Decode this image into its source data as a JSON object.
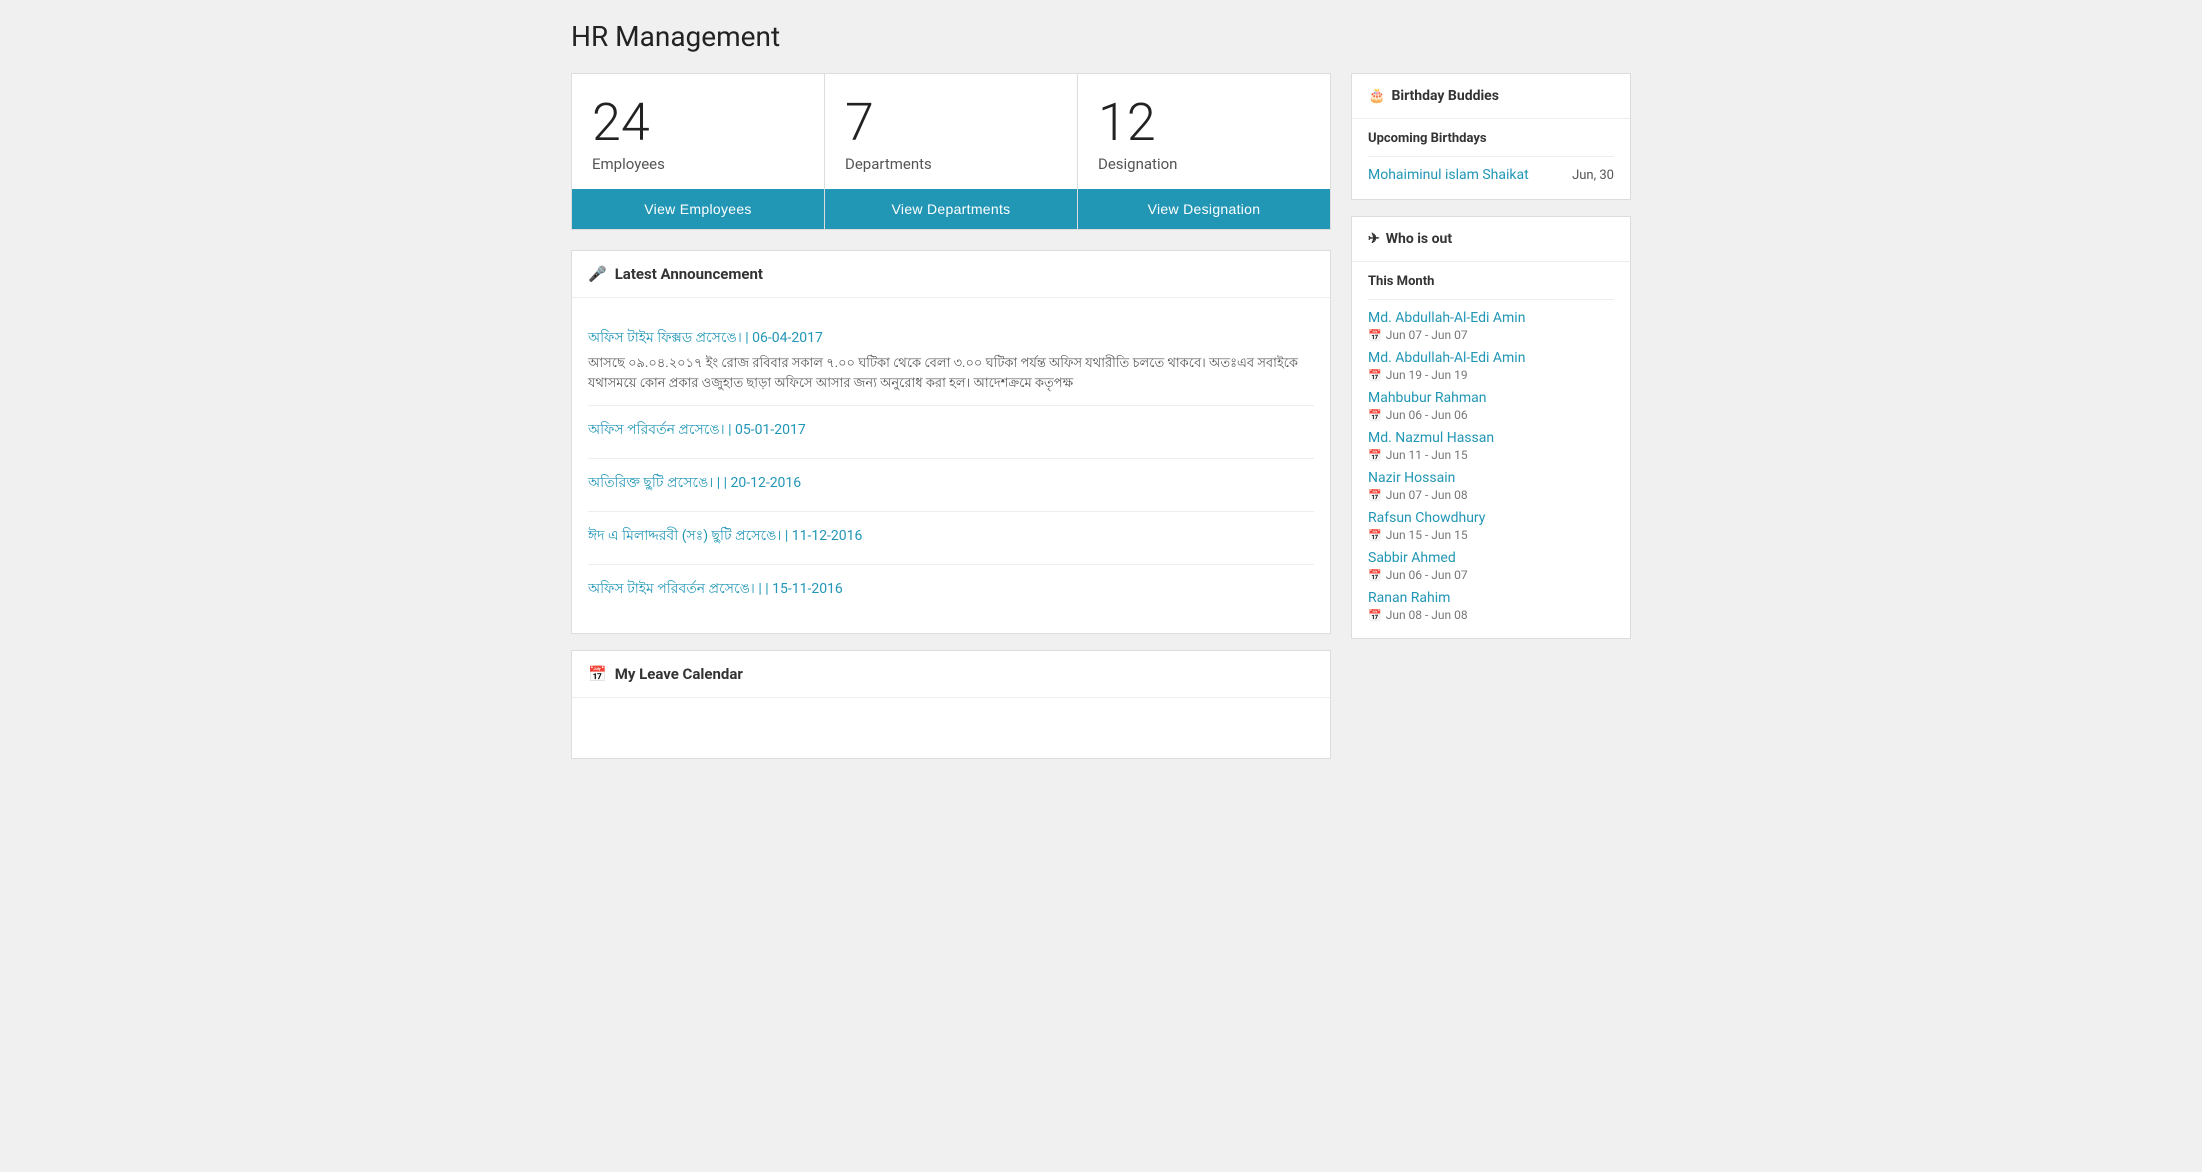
{
  "page": {
    "title": "HR Management"
  },
  "stat_cards": [
    {
      "number": "24",
      "label": "Employees",
      "button_label": "View Employees"
    },
    {
      "number": "7",
      "label": "Departments",
      "button_label": "View Departments"
    },
    {
      "number": "12",
      "label": "Designation",
      "button_label": "View Designation"
    }
  ],
  "latest_announcement": {
    "header": "Latest Announcement",
    "icon": "🎤",
    "items": [
      {
        "title": "অফিস টাইম ফিক্সড প্রসেঙে। | 06-04-2017",
        "detail": "আসছে ০৯.০৪.২০১৭ ইং রোজ রবিবার সকাল ৭.০০ ঘটিকা থেকে বেলা ৩.০০ ঘটিকা পর্যন্ত অফিস যথারীতি চলতে থাকবে। অতঃএব সবাইকে যথাসময়ে কোন প্রকার ওজুহাত ছাড়া অফিসে আসার জন্য অনুরোধ করা হল। আদেশক্রমে কতৃপক্ষ"
      },
      {
        "title": "অফিস পরিবর্তন প্রসেঙে। | 05-01-2017",
        "detail": ""
      },
      {
        "title": "অতিরিক্ত ছুটি প্রসেঙে। | | 20-12-2016",
        "detail": ""
      },
      {
        "title": "ঈদ এ মিলাদ্দরবী (সঃ) ছুটি প্রসেঙে। | 11-12-2016",
        "detail": ""
      },
      {
        "title": "অফিস টাইম পরিবর্তন প্রসেঙে। | | 15-11-2016",
        "detail": ""
      }
    ]
  },
  "my_leave_calendar": {
    "header": "My Leave Calendar",
    "icon": "📅"
  },
  "birthday_buddies": {
    "header": "Birthday Buddies",
    "icon": "🎂",
    "subtitle": "Upcoming Birthdays",
    "items": [
      {
        "name": "Mohaiminul islam Shaikat",
        "date": "Jun, 30"
      }
    ]
  },
  "who_is_out": {
    "header": "Who is out",
    "icon": "✈",
    "subtitle": "This Month",
    "items": [
      {
        "name": "Md. Abdullah-Al-Edi Amin",
        "dates": "Jun 07 - Jun 07"
      },
      {
        "name": "Md. Abdullah-Al-Edi Amin",
        "dates": "Jun 19 - Jun 19"
      },
      {
        "name": "Mahbubur Rahman",
        "dates": "Jun 06 - Jun 06"
      },
      {
        "name": "Md. Nazmul Hassan",
        "dates": "Jun 11 - Jun 15"
      },
      {
        "name": "Nazir Hossain",
        "dates": "Jun 07 - Jun 08"
      },
      {
        "name": "Rafsun Chowdhury",
        "dates": "Jun 15 - Jun 15"
      },
      {
        "name": "Sabbir Ahmed",
        "dates": "Jun 06 - Jun 07"
      },
      {
        "name": "Ranan Rahim",
        "dates": "Jun 08 - Jun 08"
      }
    ]
  }
}
